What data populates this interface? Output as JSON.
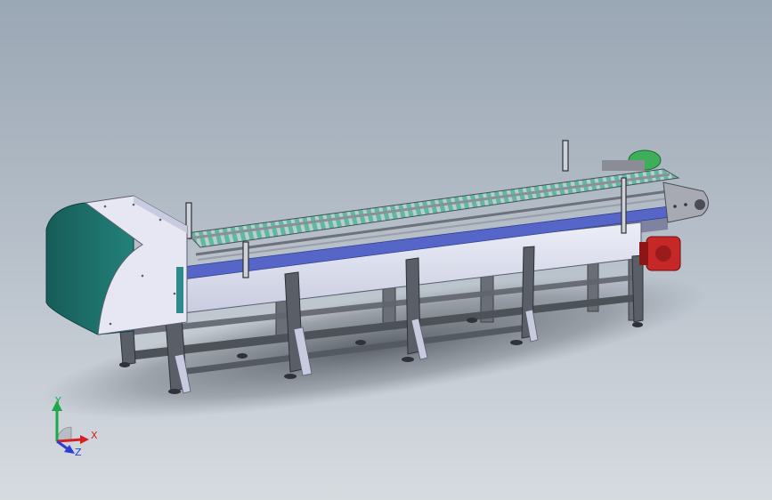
{
  "triad": {
    "x_label": "X",
    "y_label": "Y",
    "z_label": "Z",
    "x_color": "#d81e1e",
    "y_color": "#1fa84a",
    "z_color": "#2a3fd1"
  },
  "colors": {
    "background_top": "#9aa7b4",
    "background_bottom": "#d6dbe0",
    "cover_green": "#1d6f6a",
    "cover_panel": "#e6e7f3",
    "belt_teal": "#6fc0b0",
    "blue_rail": "#5566c8",
    "frame_steel": "#5a5e66",
    "motor_red": "#c62828",
    "drive_green": "#3fae5a"
  }
}
